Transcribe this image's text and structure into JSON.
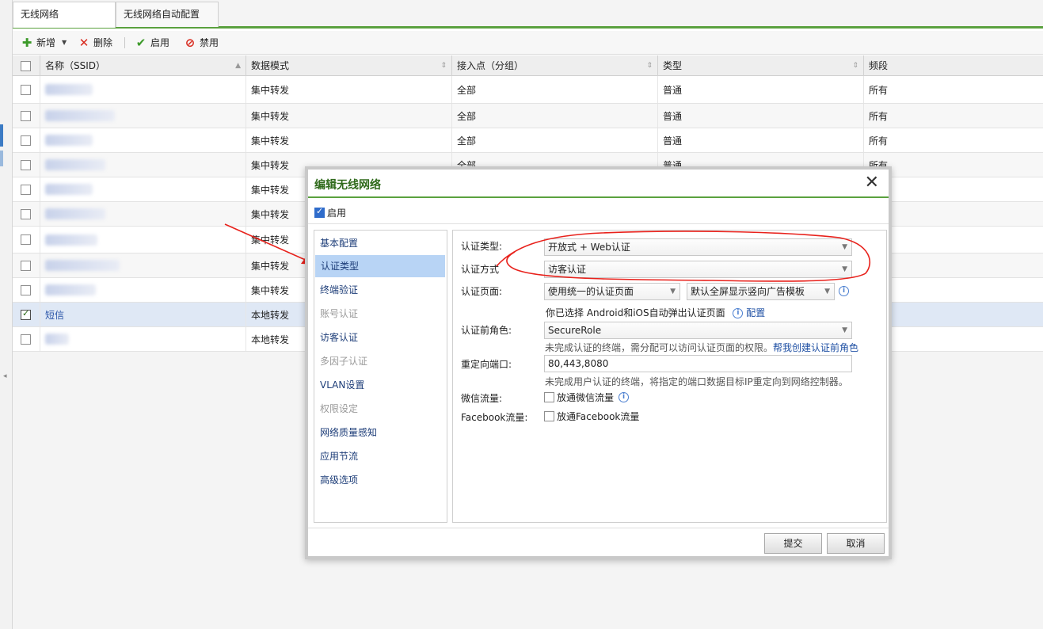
{
  "tabs": [
    {
      "label": "无线网络"
    },
    {
      "label": "无线网络自动配置"
    }
  ],
  "toolbar": {
    "add_label": "新增",
    "delete_label": "删除",
    "enable_label": "启用",
    "disable_label": "禁用"
  },
  "grid": {
    "columns": [
      "名称（SSID）",
      "数据模式",
      "接入点（分组）",
      "类型",
      "频段"
    ],
    "rows": [
      {
        "name": "",
        "data_mode": "集中转发",
        "ap": "全部",
        "type": "普通",
        "band": "所有",
        "checked": false
      },
      {
        "name": "",
        "data_mode": "集中转发",
        "ap": "全部",
        "type": "普通",
        "band": "所有",
        "checked": false
      },
      {
        "name": "",
        "data_mode": "集中转发",
        "ap": "全部",
        "type": "普通",
        "band": "所有",
        "checked": false
      },
      {
        "name": "",
        "data_mode": "集中转发",
        "ap": "全部",
        "type": "普通",
        "band": "所有",
        "checked": false
      },
      {
        "name": "",
        "data_mode": "集中转发",
        "ap": "",
        "type": "",
        "band": "",
        "checked": false
      },
      {
        "name": "",
        "data_mode": "集中转发",
        "ap": "",
        "type": "",
        "band": "",
        "checked": false
      },
      {
        "name": "",
        "data_mode": "集中转发",
        "ap": "",
        "type": "",
        "band": "",
        "checked": false
      },
      {
        "name": "",
        "data_mode": "集中转发",
        "ap": "",
        "type": "",
        "band": "",
        "checked": false
      },
      {
        "name": "",
        "data_mode": "集中转发",
        "ap": "",
        "type": "",
        "band": "",
        "checked": false
      },
      {
        "name": "短信",
        "data_mode": "本地转发",
        "ap": "",
        "type": "",
        "band": "",
        "checked": true
      },
      {
        "name": "",
        "data_mode": "本地转发",
        "ap": "",
        "type": "",
        "band": "",
        "checked": false
      }
    ]
  },
  "dialog": {
    "title": "编辑无线网络",
    "close_glyph": "✕",
    "enable_label": "启用",
    "menu": [
      {
        "label": "基本配置",
        "state": "normal"
      },
      {
        "label": "认证类型",
        "state": "active"
      },
      {
        "label": "终端验证",
        "state": "normal"
      },
      {
        "label": "账号认证",
        "state": "disabled"
      },
      {
        "label": "访客认证",
        "state": "normal"
      },
      {
        "label": "多因子认证",
        "state": "disabled"
      },
      {
        "label": "VLAN设置",
        "state": "normal"
      },
      {
        "label": "权限设定",
        "state": "disabled"
      },
      {
        "label": "网络质量感知",
        "state": "normal"
      },
      {
        "label": "应用节流",
        "state": "normal"
      },
      {
        "label": "高级选项",
        "state": "normal"
      }
    ],
    "form": {
      "auth_type_label": "认证类型:",
      "auth_type_value": "开放式 + Web认证",
      "auth_method_label": "认证方式",
      "auth_method_value": "访客认证",
      "auth_page_label": "认证页面:",
      "auth_page_value": "使用统一的认证页面",
      "template_value": "默认全屏显示竖向广告模板",
      "android_hint": "你已选择 Android和iOS自动弹出认证页面",
      "config_link": "配置",
      "pre_role_label": "认证前角色:",
      "pre_role_value": "SecureRole",
      "pre_role_hint": "未完成认证的终端，需分配可以访问认证页面的权限。",
      "pre_role_link": "帮我创建认证前角色",
      "redirect_label": "重定向端口:",
      "redirect_value": "80,443,8080",
      "redirect_hint": "未完成用户认证的终端，将指定的端口数据目标IP重定向到网络控制器。",
      "wechat_label": "微信流量:",
      "wechat_option": "放通微信流量",
      "facebook_label": "Facebook流量:",
      "facebook_option": "放通Facebook流量"
    },
    "submit_label": "提交",
    "cancel_label": "取消"
  },
  "colors": {
    "accent_green": "#5aa13e",
    "title_green": "#2f6a1b",
    "annotation_red": "#e8211b",
    "selection_blue": "#b8d4f5"
  }
}
